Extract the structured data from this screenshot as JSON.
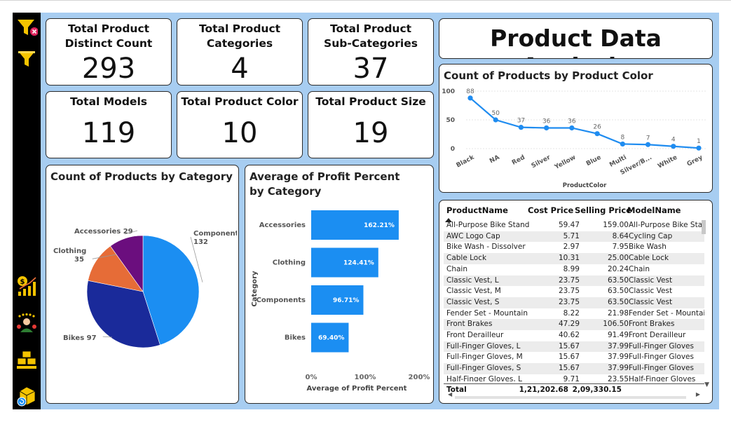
{
  "kpis": [
    {
      "title": "Total Product Distinct Count",
      "value": "293"
    },
    {
      "title": "Total Product Categories",
      "value": "4"
    },
    {
      "title": "Total Product Sub-Categories",
      "value": "37"
    },
    {
      "title": "Total Models",
      "value": "119"
    },
    {
      "title": "Total Product Color",
      "value": "10"
    },
    {
      "title": "Total Product Size",
      "value": "19"
    }
  ],
  "page_title": "Product Data Analysis",
  "sidebar": {
    "icons": [
      "filter-clear-icon",
      "filter-icon",
      "sales-growth-icon",
      "customers-icon",
      "products-icon",
      "returns-icon"
    ],
    "accent": "#f5c400"
  },
  "color_chart_title": "Count of Products by Product Color",
  "category_pie_title": "Count of Products by Category",
  "profit_chart_title": "Average of Profit Percent by Category",
  "chart_data": [
    {
      "type": "line",
      "title": "Count of Products by Product Color",
      "xlabel": "ProductColor",
      "ylabel": "",
      "categories": [
        "Black",
        "NA",
        "Red",
        "Silver",
        "Yellow",
        "Blue",
        "Multi",
        "Silver/B...",
        "White",
        "Grey"
      ],
      "values": [
        88,
        50,
        37,
        36,
        36,
        26,
        8,
        7,
        4,
        1
      ],
      "ylim": [
        0,
        100
      ],
      "yticks": [
        0,
        50,
        100
      ],
      "color": "#1f8cf0",
      "grid": true
    },
    {
      "type": "pie",
      "title": "Count of Products by Category",
      "categories": [
        "Components",
        "Bikes",
        "Clothing",
        "Accessories"
      ],
      "values": [
        132,
        97,
        35,
        29
      ],
      "colors": [
        "#1b8ef2",
        "#1a2a9a",
        "#e66c37",
        "#6b0e7e"
      ]
    },
    {
      "type": "bar",
      "title": "Average of Profit Percent by Category",
      "xlabel": "Average of Profit Percent",
      "ylabel": "Category",
      "categories": [
        "Accessories",
        "Clothing",
        "Components",
        "Bikes"
      ],
      "values": [
        162.21,
        124.41,
        96.71,
        69.4
      ],
      "data_labels": [
        "162.21%",
        "124.41%",
        "96.71%",
        "69.40%"
      ],
      "xticks": [
        "0%",
        "100%",
        "200%"
      ],
      "xlim": [
        0,
        200
      ],
      "color": "#1b8ef2"
    },
    {
      "type": "table",
      "columns": [
        "ProductName",
        "Cost Price",
        "Selling Price",
        "ModelName"
      ],
      "rows": [
        [
          "All-Purpose Bike Stand",
          "59.47",
          "159.00",
          "All-Purpose Bike Stand"
        ],
        [
          "AWC Logo Cap",
          "5.71",
          "8.64",
          "Cycling Cap"
        ],
        [
          "Bike Wash - Dissolver",
          "2.97",
          "7.95",
          "Bike Wash"
        ],
        [
          "Cable Lock",
          "10.31",
          "25.00",
          "Cable Lock"
        ],
        [
          "Chain",
          "8.99",
          "20.24",
          "Chain"
        ],
        [
          "Classic Vest, L",
          "23.75",
          "63.50",
          "Classic Vest"
        ],
        [
          "Classic Vest, M",
          "23.75",
          "63.50",
          "Classic Vest"
        ],
        [
          "Classic Vest, S",
          "23.75",
          "63.50",
          "Classic Vest"
        ],
        [
          "Fender Set - Mountain",
          "8.22",
          "21.98",
          "Fender Set - Mountain"
        ],
        [
          "Front Brakes",
          "47.29",
          "106.50",
          "Front Brakes"
        ],
        [
          "Front Derailleur",
          "40.62",
          "91.49",
          "Front Derailleur"
        ],
        [
          "Full-Finger Gloves, L",
          "15.67",
          "37.99",
          "Full-Finger Gloves"
        ],
        [
          "Full-Finger Gloves, M",
          "15.67",
          "37.99",
          "Full-Finger Gloves"
        ],
        [
          "Full-Finger Gloves, S",
          "15.67",
          "37.99",
          "Full-Finger Gloves"
        ],
        [
          "Half-Finger Gloves, L",
          "9.71",
          "23.55",
          "Half-Finger Gloves"
        ]
      ],
      "total": {
        "label": "Total",
        "cost": "1,21,202.68",
        "selling": "2,09,330.15"
      }
    }
  ]
}
